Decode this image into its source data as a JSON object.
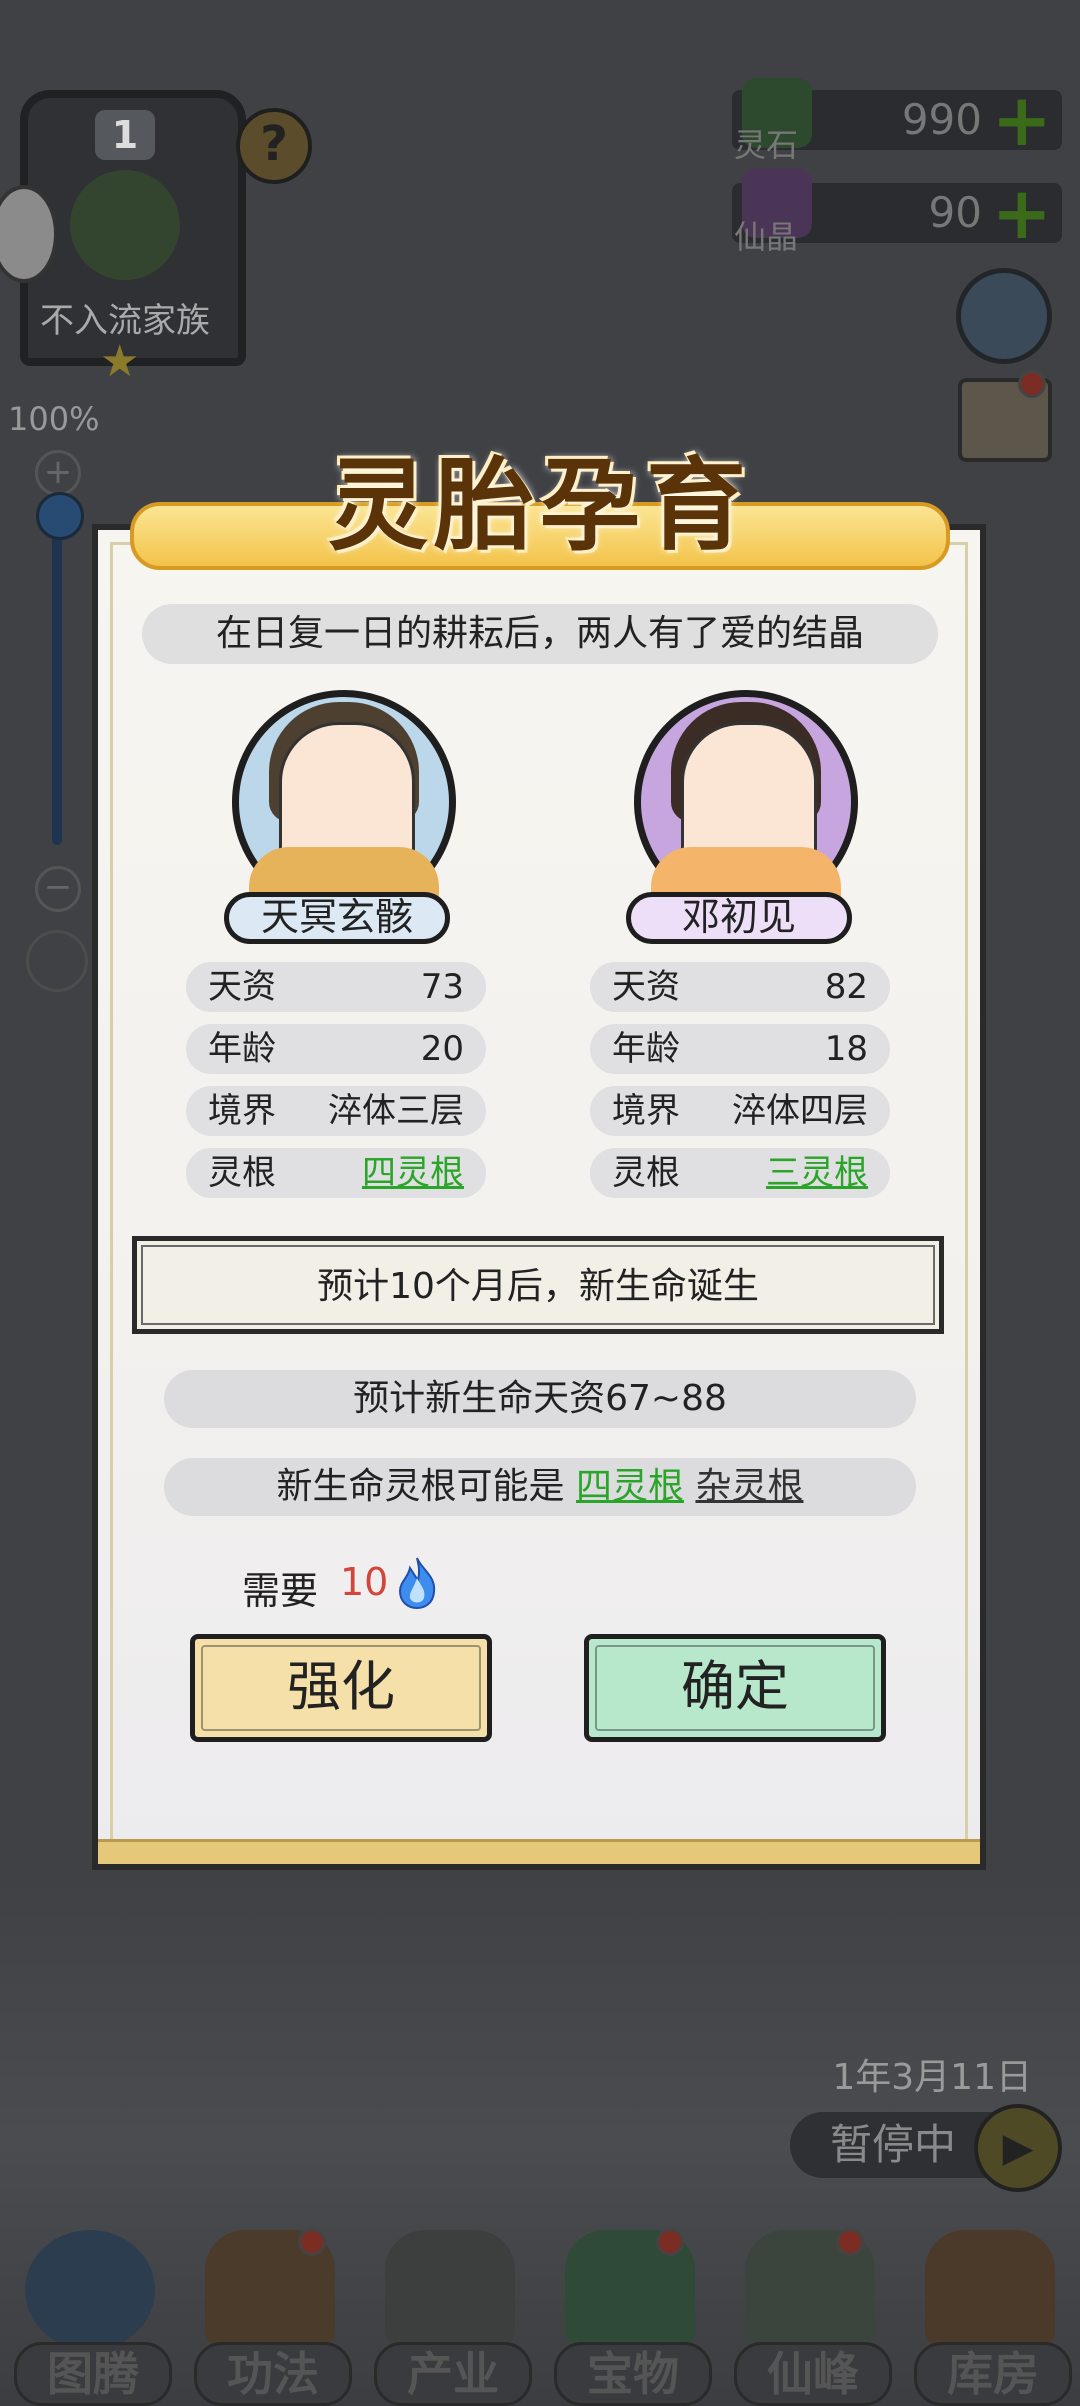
{
  "hud": {
    "family_level": "1",
    "family_name": "不入流家族",
    "zoom": "100%",
    "spirit_stone_label": "灵石",
    "spirit_stone_value": "990",
    "crystal_label": "仙晶",
    "crystal_value": "90",
    "date": "1年3月11日",
    "pause_label": "暂停中"
  },
  "nav": [
    {
      "label": "图腾"
    },
    {
      "label": "功法"
    },
    {
      "label": "产业"
    },
    {
      "label": "宝物"
    },
    {
      "label": "仙峰"
    },
    {
      "label": "库房"
    }
  ],
  "dialog": {
    "title": "灵胎孕育",
    "intro": "在日复一日的耕耘后，两人有了爱的结晶",
    "father": {
      "name": "天冥玄骸",
      "talent_label": "天资",
      "talent": "73",
      "age_label": "年龄",
      "age": "20",
      "realm_label": "境界",
      "realm": "淬体三层",
      "root_label": "灵根",
      "root": "四灵根"
    },
    "mother": {
      "name": "邓初见",
      "talent_label": "天资",
      "talent": "82",
      "age_label": "年龄",
      "age": "18",
      "realm_label": "境界",
      "realm": "淬体四层",
      "root_label": "灵根",
      "root": "三灵根"
    },
    "forecast": "预计10个月后，新生命诞生",
    "talent_forecast": "预计新生命天资67~88",
    "root_forecast_prefix": "新生命灵根可能是",
    "root_option_1": "四灵根",
    "root_option_2": "杂灵根",
    "need_label": "需要",
    "need_value": "10",
    "enhance_button": "强化",
    "confirm_button": "确定"
  },
  "colors": {
    "banner_gold": "#f3c34a",
    "title_brown": "#5a3308",
    "link_green": "#2aa52a",
    "cost_red": "#d0463a",
    "enhance_bg": "#f5e0a9",
    "confirm_bg": "#b8e8cc"
  }
}
